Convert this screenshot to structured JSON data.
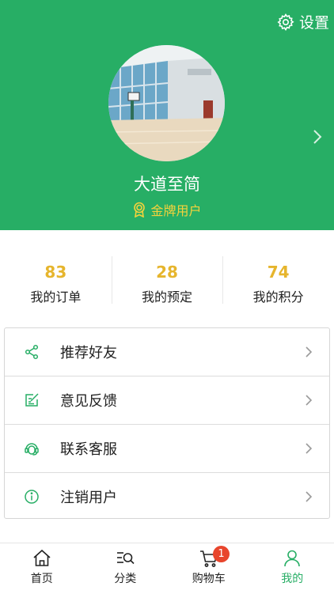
{
  "header": {
    "settings_label": "设置",
    "username": "大道至简",
    "badge_label": "金牌用户",
    "colors": {
      "background": "#27ae65",
      "badge": "#f4d23c"
    }
  },
  "stats": [
    {
      "value": "83",
      "label": "我的订单"
    },
    {
      "value": "28",
      "label": "我的预定"
    },
    {
      "value": "74",
      "label": "我的积分"
    }
  ],
  "menu": [
    {
      "label": "推荐好友",
      "icon": "share-icon"
    },
    {
      "label": "意见反馈",
      "icon": "feedback-icon"
    },
    {
      "label": "联系客服",
      "icon": "customer-service-icon"
    },
    {
      "label": "注销用户",
      "icon": "info-icon"
    }
  ],
  "tabbar": {
    "items": [
      {
        "label": "首页",
        "icon": "home-icon"
      },
      {
        "label": "分类",
        "icon": "category-search-icon"
      },
      {
        "label": "购物车",
        "icon": "cart-icon",
        "badge": "1"
      },
      {
        "label": "我的",
        "icon": "user-icon",
        "active": true
      }
    ],
    "active_color": "#27ae65",
    "badge_color": "#e8452c"
  }
}
